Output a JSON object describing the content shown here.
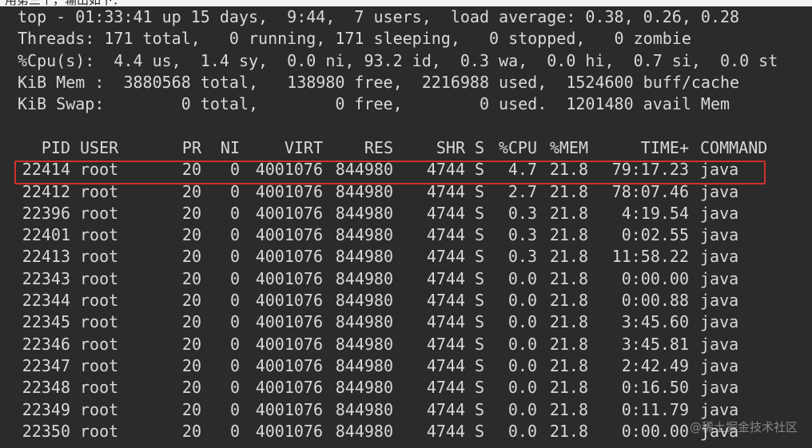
{
  "caption_fragment": "用第三个，输出如下：",
  "summary": [
    "top - 01:33:41 up 15 days,  9:44,  7 users,  load average: 0.38, 0.26, 0.28",
    "Threads: 171 total,   0 running, 171 sleeping,   0 stopped,   0 zombie",
    "%Cpu(s):  4.4 us,  1.4 sy,  0.0 ni, 93.2 id,  0.3 wa,  0.0 hi,  0.7 si,  0.0 st",
    "KiB Mem :  3880568 total,   138980 free,  2216988 used,  1524600 buff/cache",
    "KiB Swap:        0 total,        0 free,        0 used.  1201480 avail Mem"
  ],
  "columns": {
    "pid": "PID",
    "user": "USER",
    "pr": "PR",
    "ni": "NI",
    "virt": "VIRT",
    "res": "RES",
    "shr": "SHR",
    "s": "S",
    "cpu": "%CPU",
    "mem": "%MEM",
    "time": "TIME+",
    "command": "COMMAND"
  },
  "rows": [
    {
      "pid": "22414",
      "user": "root",
      "pr": "20",
      "ni": "0",
      "virt": "4001076",
      "res": "844980",
      "shr": "4744",
      "s": "S",
      "cpu": "4.7",
      "mem": "21.8",
      "time": "79:17.23",
      "command": "java"
    },
    {
      "pid": "22412",
      "user": "root",
      "pr": "20",
      "ni": "0",
      "virt": "4001076",
      "res": "844980",
      "shr": "4744",
      "s": "S",
      "cpu": "2.7",
      "mem": "21.8",
      "time": "78:07.46",
      "command": "java"
    },
    {
      "pid": "22396",
      "user": "root",
      "pr": "20",
      "ni": "0",
      "virt": "4001076",
      "res": "844980",
      "shr": "4744",
      "s": "S",
      "cpu": "0.3",
      "mem": "21.8",
      "time": "4:19.54",
      "command": "java"
    },
    {
      "pid": "22401",
      "user": "root",
      "pr": "20",
      "ni": "0",
      "virt": "4001076",
      "res": "844980",
      "shr": "4744",
      "s": "S",
      "cpu": "0.3",
      "mem": "21.8",
      "time": "0:02.55",
      "command": "java"
    },
    {
      "pid": "22413",
      "user": "root",
      "pr": "20",
      "ni": "0",
      "virt": "4001076",
      "res": "844980",
      "shr": "4744",
      "s": "S",
      "cpu": "0.3",
      "mem": "21.8",
      "time": "11:58.22",
      "command": "java"
    },
    {
      "pid": "22343",
      "user": "root",
      "pr": "20",
      "ni": "0",
      "virt": "4001076",
      "res": "844980",
      "shr": "4744",
      "s": "S",
      "cpu": "0.0",
      "mem": "21.8",
      "time": "0:00.00",
      "command": "java"
    },
    {
      "pid": "22344",
      "user": "root",
      "pr": "20",
      "ni": "0",
      "virt": "4001076",
      "res": "844980",
      "shr": "4744",
      "s": "S",
      "cpu": "0.0",
      "mem": "21.8",
      "time": "0:00.88",
      "command": "java"
    },
    {
      "pid": "22345",
      "user": "root",
      "pr": "20",
      "ni": "0",
      "virt": "4001076",
      "res": "844980",
      "shr": "4744",
      "s": "S",
      "cpu": "0.0",
      "mem": "21.8",
      "time": "3:45.60",
      "command": "java"
    },
    {
      "pid": "22346",
      "user": "root",
      "pr": "20",
      "ni": "0",
      "virt": "4001076",
      "res": "844980",
      "shr": "4744",
      "s": "S",
      "cpu": "0.0",
      "mem": "21.8",
      "time": "3:45.81",
      "command": "java"
    },
    {
      "pid": "22347",
      "user": "root",
      "pr": "20",
      "ni": "0",
      "virt": "4001076",
      "res": "844980",
      "shr": "4744",
      "s": "S",
      "cpu": "0.0",
      "mem": "21.8",
      "time": "2:42.49",
      "command": "java"
    },
    {
      "pid": "22348",
      "user": "root",
      "pr": "20",
      "ni": "0",
      "virt": "4001076",
      "res": "844980",
      "shr": "4744",
      "s": "S",
      "cpu": "0.0",
      "mem": "21.8",
      "time": "0:16.50",
      "command": "java"
    },
    {
      "pid": "22349",
      "user": "root",
      "pr": "20",
      "ni": "0",
      "virt": "4001076",
      "res": "844980",
      "shr": "4744",
      "s": "S",
      "cpu": "0.0",
      "mem": "21.8",
      "time": "0:11.79",
      "command": "java"
    },
    {
      "pid": "22350",
      "user": "root",
      "pr": "20",
      "ni": "0",
      "virt": "4001076",
      "res": "844980",
      "shr": "4744",
      "s": "S",
      "cpu": "0.0",
      "mem": "21.8",
      "time": "0:00.00",
      "command": "java"
    }
  ],
  "watermark": "@稀土掘金技术社区",
  "colors": {
    "terminal_bg": "#2b2b2b",
    "terminal_fg": "#d9d9d9",
    "highlight": "#d0312d"
  }
}
